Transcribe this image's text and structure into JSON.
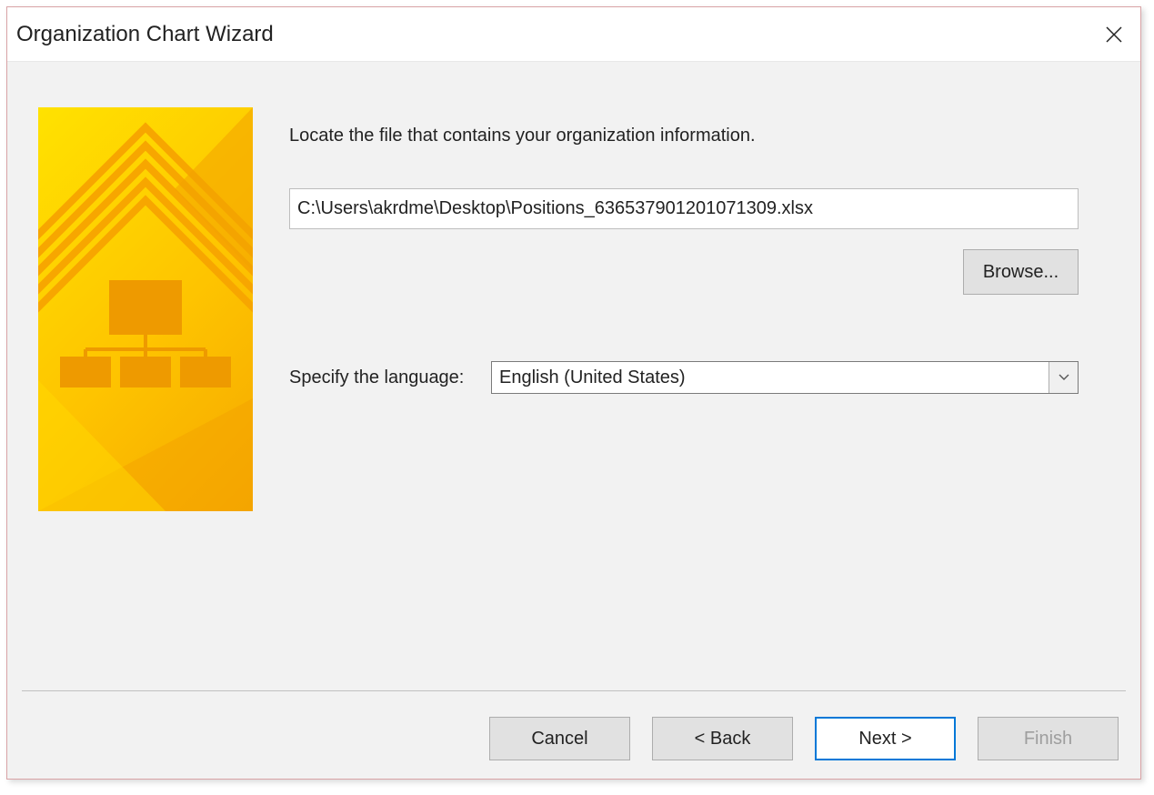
{
  "dialog": {
    "title": "Organization Chart Wizard",
    "instruction": "Locate the file that contains your organization information.",
    "file_path": "C:\\Users\\akrdme\\Desktop\\Positions_636537901201071309.xlsx",
    "browse_label": "Browse...",
    "language_label": "Specify the language:",
    "language_value": "English (United States)",
    "buttons": {
      "cancel": "Cancel",
      "back": "< Back",
      "next": "Next >",
      "finish": "Finish"
    }
  }
}
